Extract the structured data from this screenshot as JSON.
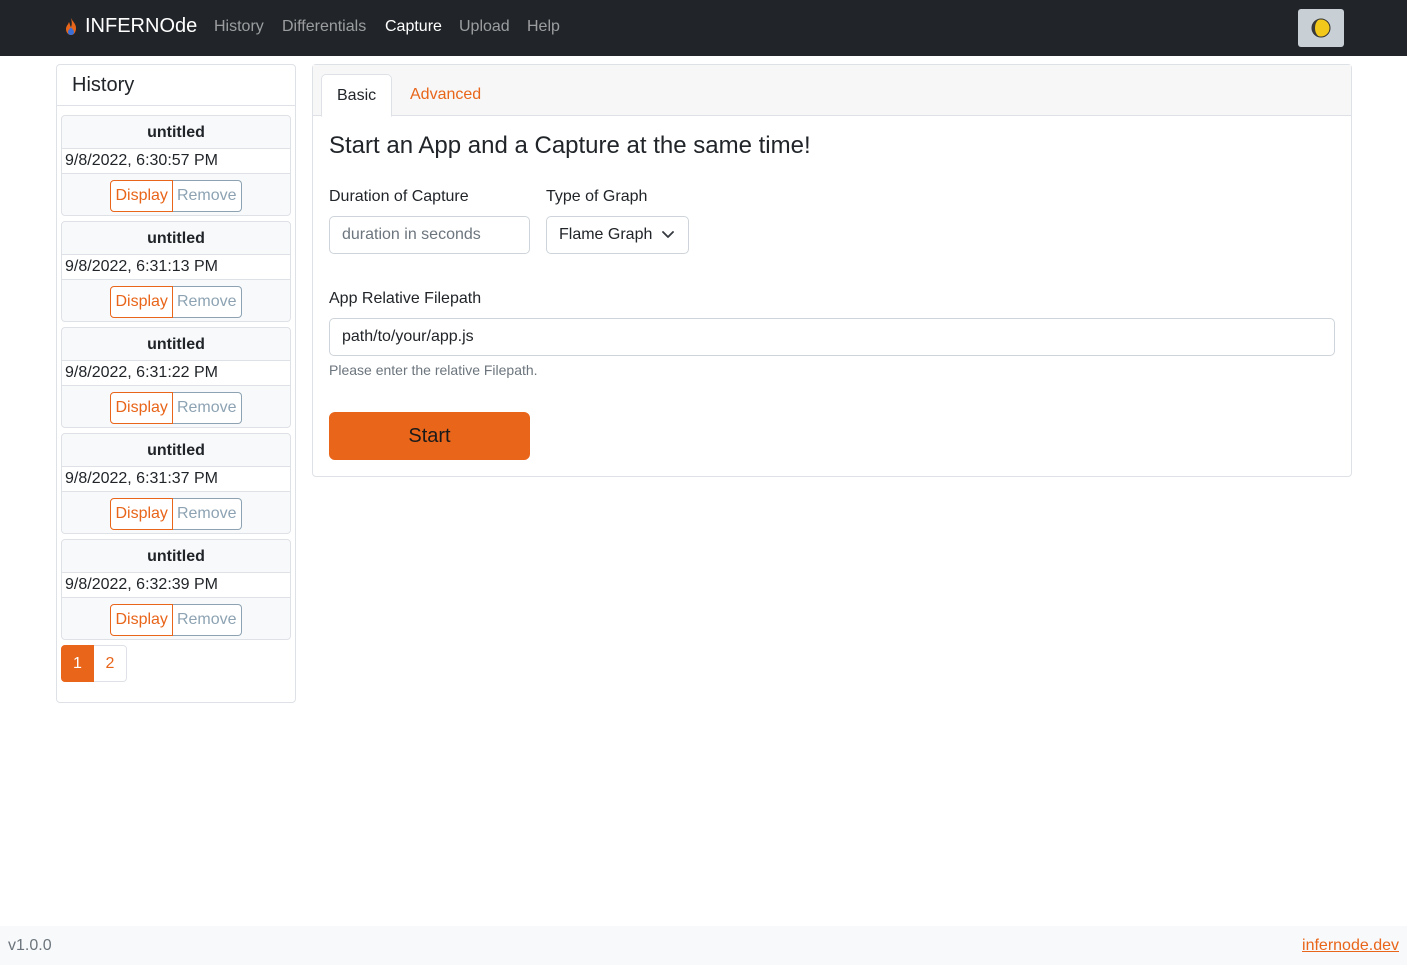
{
  "navbar": {
    "brand": "INFERNOde",
    "links": [
      {
        "label": "History",
        "active": false
      },
      {
        "label": "Differentials",
        "active": false
      },
      {
        "label": "Capture",
        "active": true
      },
      {
        "label": "Upload",
        "active": false
      },
      {
        "label": "Help",
        "active": false
      }
    ],
    "theme_toggle_icon": "moon-icon"
  },
  "history": {
    "title": "History",
    "items": [
      {
        "name": "untitled",
        "time": "9/8/2022, 6:30:57 PM",
        "display_label": "Display",
        "remove_label": "Remove"
      },
      {
        "name": "untitled",
        "time": "9/8/2022, 6:31:13 PM",
        "display_label": "Display",
        "remove_label": "Remove"
      },
      {
        "name": "untitled",
        "time": "9/8/2022, 6:31:22 PM",
        "display_label": "Display",
        "remove_label": "Remove"
      },
      {
        "name": "untitled",
        "time": "9/8/2022, 6:31:37 PM",
        "display_label": "Display",
        "remove_label": "Remove"
      },
      {
        "name": "untitled",
        "time": "9/8/2022, 6:32:39 PM",
        "display_label": "Display",
        "remove_label": "Remove"
      }
    ],
    "pagination": {
      "pages": [
        "1",
        "2"
      ],
      "current": "1"
    }
  },
  "capture": {
    "tabs": [
      {
        "label": "Basic",
        "active": true
      },
      {
        "label": "Advanced",
        "active": false
      }
    ],
    "title": "Start an App and a Capture at the same time!",
    "duration_label": "Duration of Capture",
    "duration_placeholder": "duration in seconds",
    "duration_value": "",
    "graph_type_label": "Type of Graph",
    "graph_type_value": "Flame Graph",
    "filepath_label": "App Relative Filepath",
    "filepath_value": "path/to/your/app.js",
    "filepath_help": "Please enter the relative Filepath.",
    "start_label": "Start"
  },
  "footer": {
    "version": "v1.0.0",
    "link": "infernode.dev"
  },
  "colors": {
    "accent": "#e8651a",
    "navbar_bg": "#212529",
    "muted": "#6c757d",
    "remove": "#8da3b3"
  }
}
